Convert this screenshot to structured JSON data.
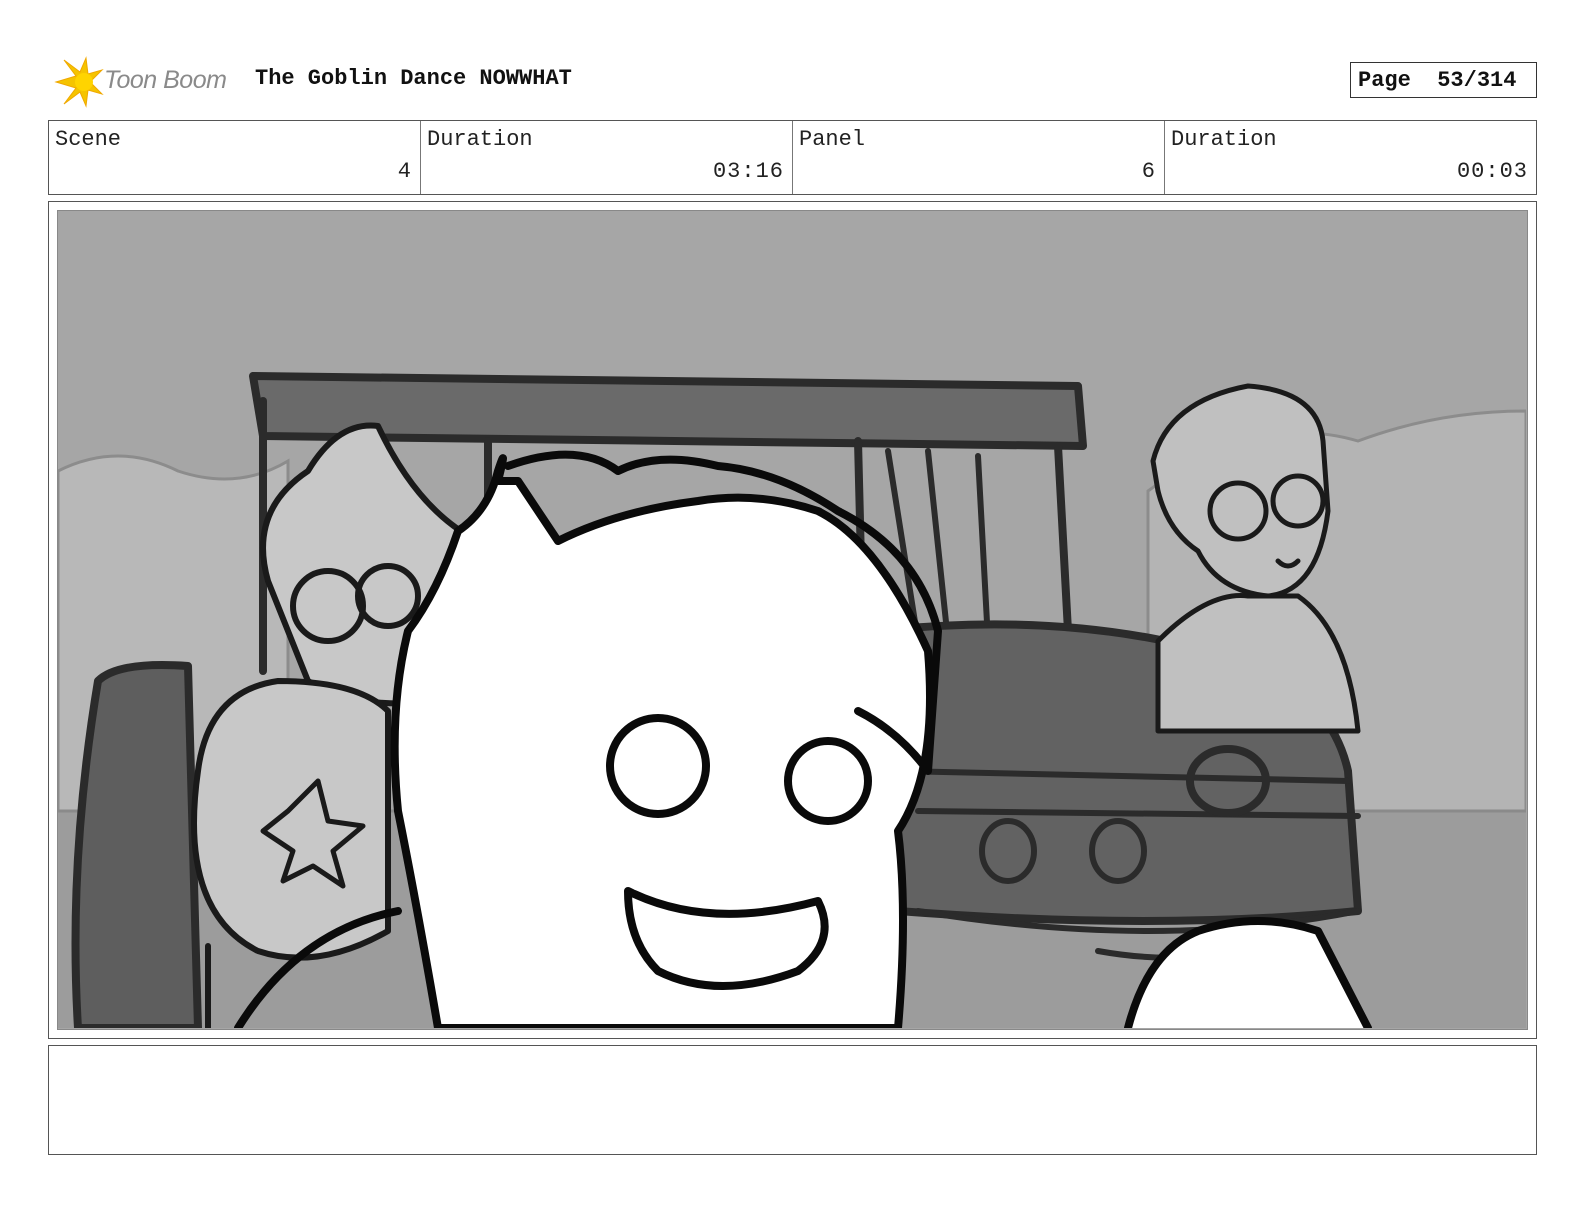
{
  "header": {
    "logo_text": "Toon Boom",
    "title": "The Goblin Dance NOWWHAT",
    "page_label": "Page",
    "page_number": "53/314"
  },
  "info": {
    "scene_label": "Scene",
    "scene_value": "4",
    "scene_duration_label": "Duration",
    "scene_duration_value": "03:16",
    "panel_label": "Panel",
    "panel_value": "6",
    "panel_duration_label": "Duration",
    "panel_duration_value": "00:03"
  },
  "notes": {
    "text": ""
  }
}
